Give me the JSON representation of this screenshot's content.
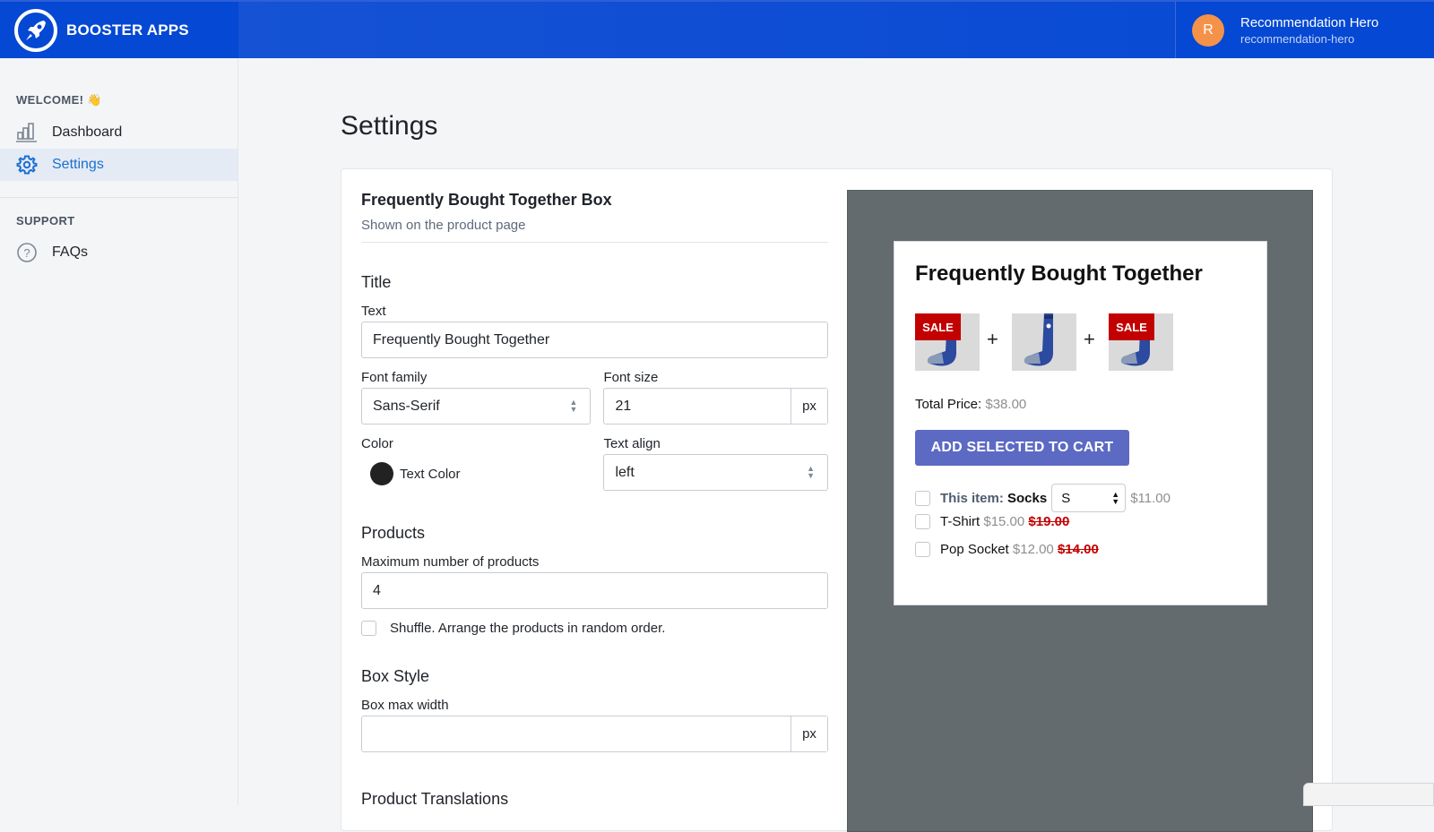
{
  "header": {
    "brand_name": "BOOSTER APPS",
    "account_initial": "R",
    "account_name": "Recommendation Hero",
    "account_handle": "recommendation-hero",
    "brand_color": "#0448d3",
    "avatar_color": "#f4924a"
  },
  "sidebar": {
    "welcome_heading": "WELCOME! 👋",
    "items": [
      {
        "label": "Dashboard",
        "icon": "bar-chart-icon",
        "active": false
      },
      {
        "label": "Settings",
        "icon": "gear-icon",
        "active": true
      }
    ],
    "support_heading": "SUPPORT",
    "support_items": [
      {
        "label": "FAQs",
        "icon": "question-circle-icon"
      }
    ]
  },
  "page": {
    "title": "Settings"
  },
  "form": {
    "section_title": "Frequently Bought Together Box",
    "section_subtitle": "Shown on the product page",
    "title_group": {
      "heading": "Title",
      "text_label": "Text",
      "text_value": "Frequently Bought Together",
      "font_family_label": "Font family",
      "font_family_value": "Sans-Serif",
      "font_size_label": "Font size",
      "font_size_value": "21",
      "font_size_unit": "px",
      "color_label": "Color",
      "color_swatch_label": "Text Color",
      "color_value": "#222222",
      "text_align_label": "Text align",
      "text_align_value": "left"
    },
    "products_group": {
      "heading": "Products",
      "max_label": "Maximum number of products",
      "max_value": "4",
      "shuffle_label": "Shuffle. Arrange the products in random order.",
      "shuffle_checked": false
    },
    "box_style_group": {
      "heading": "Box Style",
      "max_width_label": "Box max width",
      "max_width_value": "",
      "max_width_unit": "px"
    },
    "next_heading": "Product Translations"
  },
  "preview": {
    "title": "Frequently Bought Together",
    "products": [
      {
        "name": "Socks",
        "sale": true
      },
      {
        "name": "Socks",
        "sale": false
      },
      {
        "name": "Socks",
        "sale": true
      }
    ],
    "sale_label": "SALE",
    "plus": "+",
    "total_label": "Total Price:",
    "total_value": "$38.00",
    "cart_button": "ADD SELECTED TO CART",
    "button_color": "#5c6ac4",
    "items": [
      {
        "prefix": "This item:",
        "name": "Socks",
        "variant": "S",
        "price": "$11.00",
        "compare_price": ""
      },
      {
        "prefix": "",
        "name": "T-Shirt",
        "variant": "",
        "price": "$15.00",
        "compare_price": "$19.00"
      },
      {
        "prefix": "",
        "name": "Pop Socket",
        "variant": "",
        "price": "$12.00",
        "compare_price": "$14.00"
      }
    ]
  }
}
